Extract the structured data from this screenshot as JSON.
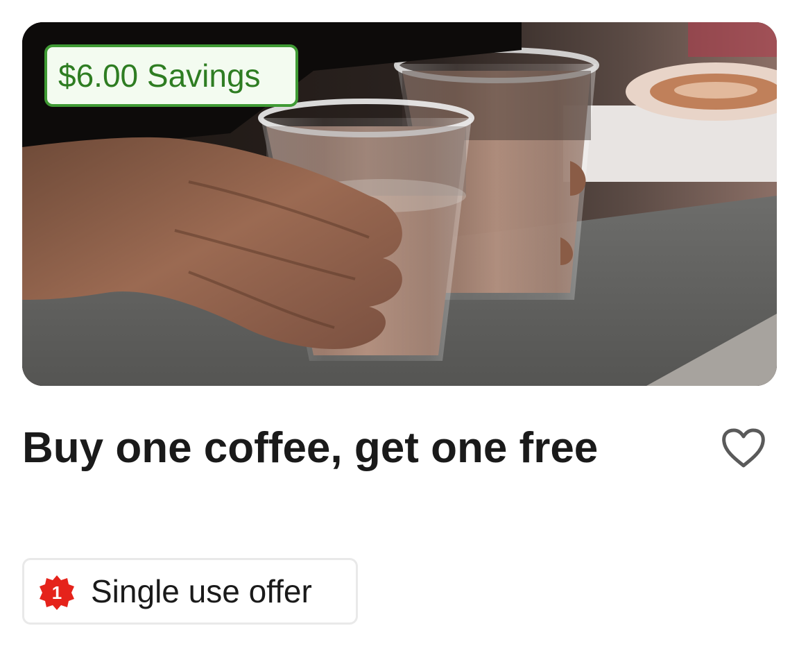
{
  "deal": {
    "savings_badge": "$6.00 Savings",
    "title": "Buy one coffee, get one free",
    "offer_type": {
      "badge_number": "1",
      "label": "Single use offer"
    }
  },
  "icons": {
    "favorite": "heart-outline-icon",
    "offer": "starburst-badge-icon"
  },
  "colors": {
    "savings_green": "#2e7d22",
    "savings_border": "#3f9a34",
    "offer_red": "#e5231b",
    "title_text": "#1a1a1a"
  }
}
